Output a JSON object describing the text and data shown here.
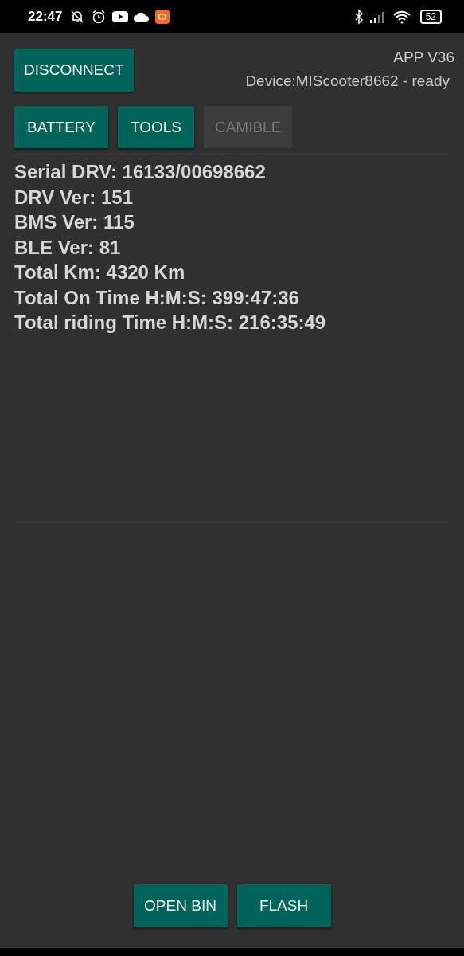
{
  "status_bar": {
    "time": "22:47",
    "battery": "52"
  },
  "disconnect_button": "DISCONNECT",
  "app_version": "APP V36",
  "device_status": "Device:MIScooter8662 - ready",
  "tabs": [
    {
      "label": "BATTERY",
      "disabled": false
    },
    {
      "label": "TOOLS",
      "disabled": false
    },
    {
      "label": "CAMIBLE",
      "disabled": true
    }
  ],
  "info_lines": [
    "Serial DRV: 16133/00698662",
    "DRV Ver: 151",
    "BMS Ver: 115",
    "BLE Ver: 81",
    "Total Km: 4320 Km",
    "Total On Time H:M:S: 399:47:36",
    "Total riding Time H:M:S: 216:35:49"
  ],
  "bottom_buttons": [
    "OPEN BIN",
    "FLASH"
  ]
}
